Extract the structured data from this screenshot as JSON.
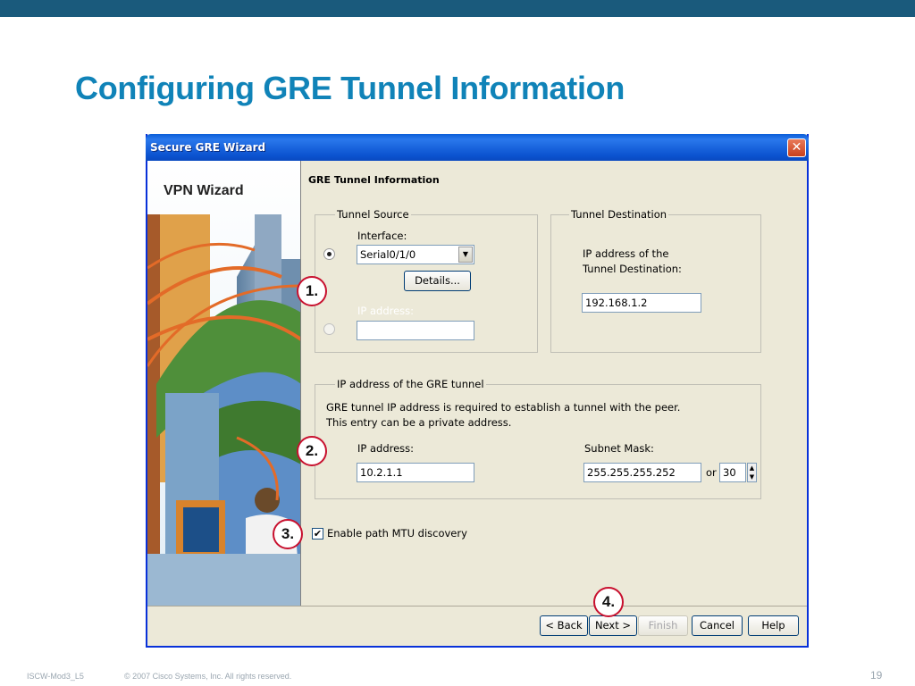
{
  "slide": {
    "title": "Configuring GRE Tunnel Information",
    "footer_left": "ISCW-Mod3_L5",
    "footer_copyright": "© 2007 Cisco Systems, Inc. All rights reserved.",
    "page_number": "19"
  },
  "window": {
    "title": "Secure GRE Wizard",
    "close_label": "✕",
    "side_label": "VPN Wizard",
    "section_title": "GRE Tunnel Information"
  },
  "tunnel_source": {
    "legend": "Tunnel Source",
    "interface_label": "Interface:",
    "interface_value": "Serial0/1/0",
    "details_button": "Details...",
    "ip_label": "IP address:",
    "ip_value": ""
  },
  "tunnel_destination": {
    "legend": "Tunnel Destination",
    "desc_line1": "IP address of the",
    "desc_line2": "Tunnel Destination:",
    "ip_value": "192.168.1.2"
  },
  "gre_tunnel": {
    "legend": "IP address of the GRE tunnel",
    "desc_line1": "GRE tunnel IP address is required to establish a tunnel with the peer.",
    "desc_line2": "This entry can be a private address.",
    "ip_label": "IP address:",
    "ip_value": "10.2.1.1",
    "mask_label": "Subnet Mask:",
    "mask_value": "255.255.255.252",
    "or_label": "or",
    "prefix_value": "30"
  },
  "mtu": {
    "label": "Enable path MTU discovery",
    "checked": true
  },
  "buttons": {
    "back": "< Back",
    "next": "Next >",
    "finish": "Finish",
    "cancel": "Cancel",
    "help": "Help"
  },
  "steps": [
    "1.",
    "2.",
    "3.",
    "4."
  ],
  "colors": {
    "title_blue": "#1083b8",
    "top_bar": "#1a5a7c",
    "step_red": "#c8102e"
  }
}
